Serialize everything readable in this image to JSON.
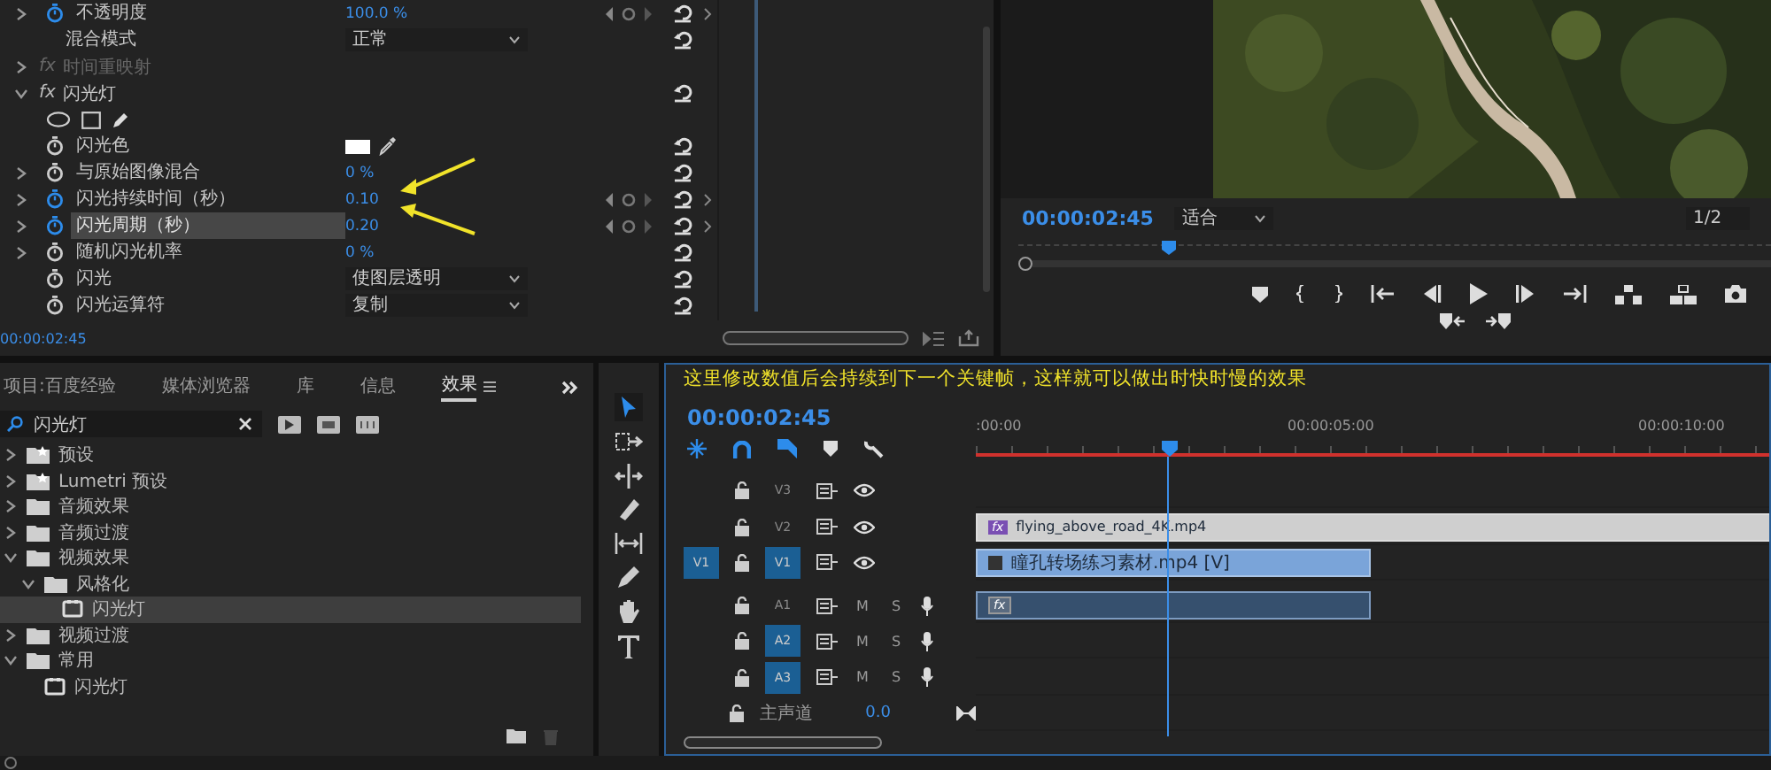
{
  "effect_controls": {
    "rows": [
      {
        "kind": "property",
        "label": "不透明度",
        "expandable": true,
        "expanded": false,
        "animated": true,
        "value": "100.0 %",
        "keyframe_nav": true,
        "reset": true,
        "selected": false
      },
      {
        "kind": "mode",
        "label": "混合模式",
        "value": "正常",
        "reset": true,
        "selected": false
      },
      {
        "kind": "effect",
        "label": "时间重映射",
        "badge": "fx",
        "expanded": false,
        "disabled": true,
        "reset": false
      },
      {
        "kind": "effect",
        "label": "闪光灯",
        "badge": "fx",
        "expanded": true,
        "disabled": false,
        "reset": true
      },
      {
        "kind": "masks"
      },
      {
        "kind": "color",
        "label": "闪光色",
        "animated": false,
        "color": "#ffffff",
        "reset": true,
        "selected": false
      },
      {
        "kind": "property",
        "label": "与原始图像混合",
        "expandable": true,
        "expanded": false,
        "animated": false,
        "value": "0 %",
        "keyframe_nav": false,
        "reset": true,
        "selected": false
      },
      {
        "kind": "property",
        "label": "闪光持续时间（秒）",
        "expandable": true,
        "expanded": false,
        "animated": true,
        "value": "0.10",
        "keyframe_nav": true,
        "reset": true,
        "selected": false
      },
      {
        "kind": "property",
        "label": "闪光周期（秒）",
        "expandable": true,
        "expanded": false,
        "animated": true,
        "value": "0.20",
        "keyframe_nav": true,
        "reset": true,
        "selected": true
      },
      {
        "kind": "property",
        "label": "随机闪光机率",
        "expandable": true,
        "expanded": false,
        "animated": false,
        "value": "0 %",
        "keyframe_nav": false,
        "reset": true,
        "selected": false
      },
      {
        "kind": "dropdown",
        "label": "闪光",
        "animated": false,
        "value": "使图层透明",
        "reset": true,
        "selected": false
      },
      {
        "kind": "dropdown",
        "label": "闪光运算符",
        "animated": false,
        "value": "复制",
        "reset": true,
        "selected": false
      }
    ],
    "timecode": "00:00:02:45"
  },
  "program_monitor": {
    "timecode": "00:00:02:45",
    "zoom": "适合",
    "resolution": "1/2"
  },
  "project": {
    "tabs": [
      {
        "label": "项目:百度经验",
        "selected": false
      },
      {
        "label": "媒体浏览器",
        "selected": false
      },
      {
        "label": "库",
        "selected": false
      },
      {
        "label": "信息",
        "selected": false
      },
      {
        "label": "效果",
        "selected": true
      }
    ],
    "search": {
      "value": "闪光灯"
    },
    "tree": [
      {
        "kind": "preset",
        "label": "预设",
        "expanded": false,
        "selected": false
      },
      {
        "kind": "preset",
        "label": "Lumetri 预设",
        "expanded": false,
        "selected": false
      },
      {
        "kind": "folder",
        "label": "音频效果",
        "expanded": false,
        "selected": false
      },
      {
        "kind": "folder",
        "label": "音频过渡",
        "expanded": false,
        "selected": false
      },
      {
        "kind": "folder",
        "label": "视频效果",
        "expanded": true,
        "selected": false,
        "children": [
          {
            "kind": "folder",
            "label": "风格化",
            "expanded": true,
            "selected": false,
            "children": [
              {
                "kind": "effect",
                "label": "闪光灯",
                "selected": true
              }
            ]
          }
        ]
      },
      {
        "kind": "folder",
        "label": "视频过渡",
        "expanded": false,
        "selected": false
      },
      {
        "kind": "folder",
        "label": "常用",
        "expanded": true,
        "selected": false,
        "children": [
          {
            "kind": "effect",
            "label": "闪光灯",
            "selected": false
          }
        ]
      }
    ]
  },
  "timeline": {
    "annotation": "这里修改数值后会持续到下一个关键帧，这样就可以做出时快时慢的效果",
    "timecode": "00:00:02:45",
    "ruler_labels": [
      ":00:00",
      "00:00:05:00",
      "00:00:10:00"
    ],
    "tracks": [
      {
        "kind": "video",
        "name": "V3",
        "targeted": false
      },
      {
        "kind": "video",
        "name": "V2",
        "targeted": false,
        "clips": [
          {
            "kind": "video",
            "name": "flying_above_road_4K.mp4",
            "badge": "fx",
            "selected": true,
            "cut_off": true
          }
        ]
      },
      {
        "kind": "video",
        "name": "V1",
        "targeted": true,
        "source": "V1",
        "clips": [
          {
            "kind": "video",
            "name": "瞳孔转场练习素材.mp4 [V]",
            "selected": false,
            "cut_off": false
          }
        ]
      },
      {
        "kind": "audio",
        "name": "A1",
        "targeted": false,
        "mute": "M",
        "solo": "S",
        "clips": [
          {
            "kind": "audio",
            "badge": "fx",
            "selected": false,
            "cut_off": false
          }
        ]
      },
      {
        "kind": "audio",
        "name": "A2",
        "targeted": true,
        "mute": "M",
        "solo": "S"
      },
      {
        "kind": "audio",
        "name": "A3",
        "targeted": true,
        "mute": "M",
        "solo": "S"
      },
      {
        "kind": "master",
        "name": "主声道",
        "value": "0.0"
      }
    ]
  }
}
